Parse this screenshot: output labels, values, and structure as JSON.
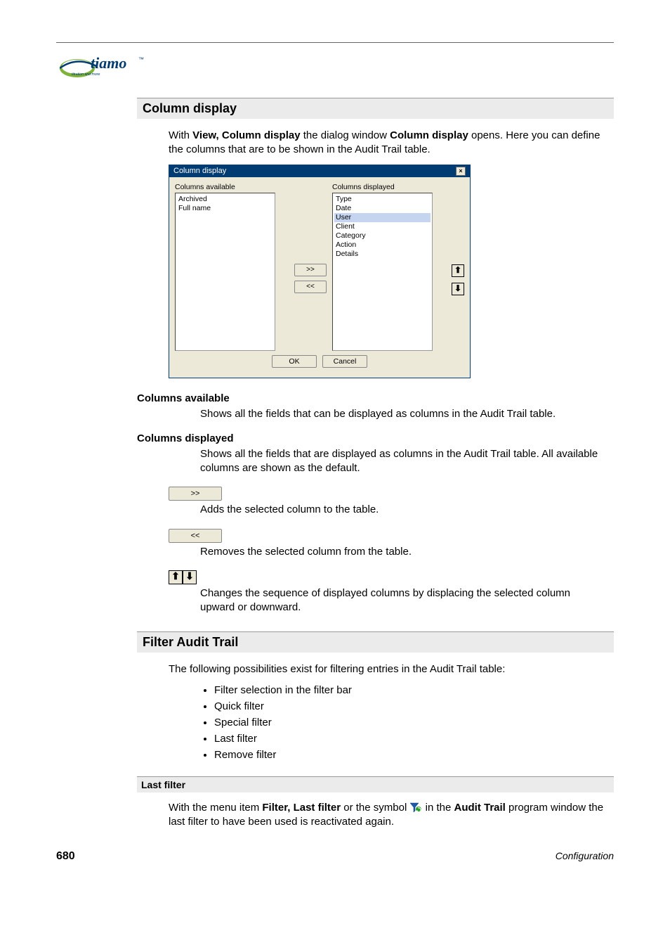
{
  "logo": {
    "brand": "tiamo",
    "tm": "™",
    "tagline": "titration and more"
  },
  "sections": {
    "column_display": {
      "title": "Column display",
      "intro_pre": "With ",
      "intro_b1": "View, Column display",
      "intro_mid": " the dialog window ",
      "intro_b2": "Column display",
      "intro_post": " opens. Here you can define the columns that are to be shown in the Audit Trail table.",
      "cols_available": {
        "heading": "Columns available",
        "text": "Shows all the fields that can be displayed as columns in the Audit Trail table."
      },
      "cols_displayed": {
        "heading": "Columns displayed",
        "text": "Shows all the fields that are displayed as columns in the Audit Trail table. All available columns are shown as the default."
      },
      "btn_add_label": ">>",
      "btn_add_desc": "Adds the selected column to the table.",
      "btn_remove_label": "<<",
      "btn_remove_desc": "Removes the selected column from the table.",
      "arrows_desc": "Changes the sequence of displayed columns by displacing the selected column upward or downward."
    },
    "filter": {
      "title": "Filter Audit Trail",
      "intro": "The following possibilities exist for filtering entries in the Audit Trail table:",
      "bullets": [
        "Filter selection in the filter bar",
        "Quick filter",
        "Special filter",
        "Last filter",
        "Remove filter"
      ],
      "last_filter": {
        "heading": "Last filter",
        "pre": "With the menu item ",
        "b1": "Filter, Last filter",
        "mid1": " or the symbol ",
        "mid2": " in the ",
        "b2": "Audit Trail",
        "post": " program window the last filter to have been used is reactivated again."
      }
    }
  },
  "dialog": {
    "title": "Column display",
    "close": "×",
    "available_label": "Columns available",
    "displayed_label": "Columns displayed",
    "available_items": [
      "Archived",
      "Full name"
    ],
    "displayed_items": [
      "Type",
      "Date",
      "User",
      "Client",
      "Category",
      "Action",
      "Details"
    ],
    "displayed_selected_index": 2,
    "move_right": ">>",
    "move_left": "<<",
    "up": "⬆",
    "down": "⬇",
    "ok": "OK",
    "cancel": "Cancel"
  },
  "footer": {
    "page": "680",
    "section": "Configuration"
  }
}
